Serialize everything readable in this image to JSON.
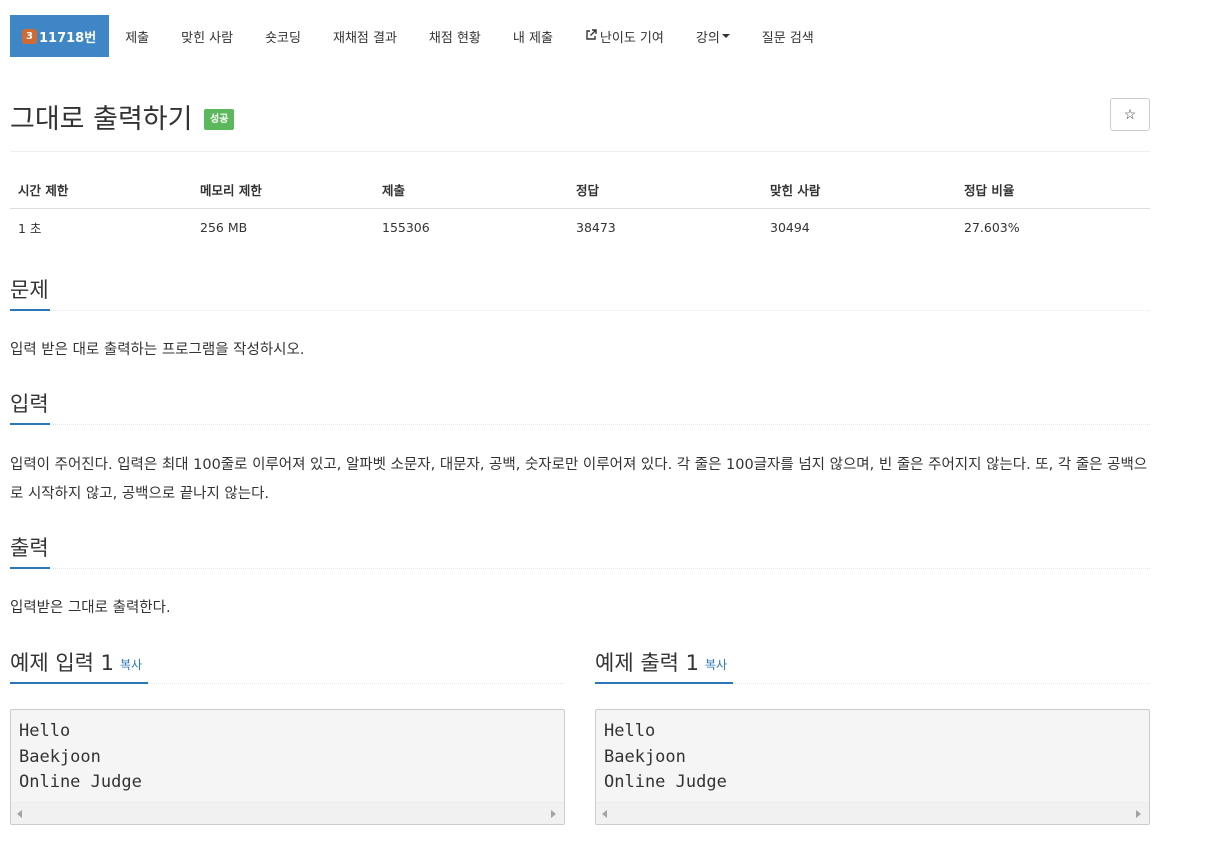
{
  "nav": {
    "problem_tier": "3",
    "problem_id": "11718번",
    "items": [
      "제출",
      "맞힌 사람",
      "숏코딩",
      "재채점 결과",
      "채점 현황",
      "내 제출",
      "난이도 기여",
      "강의",
      "질문 검색"
    ]
  },
  "problem": {
    "title": "그대로 출력하기",
    "status": "성공",
    "star_icon": "☆"
  },
  "info": {
    "headers": [
      "시간 제한",
      "메모리 제한",
      "제출",
      "정답",
      "맞힌 사람",
      "정답 비율"
    ],
    "values": [
      "1 초",
      "256 MB",
      "155306",
      "38473",
      "30494",
      "27.603%"
    ]
  },
  "sections": {
    "description": {
      "heading": "문제",
      "text": "입력 받은 대로 출력하는 프로그램을 작성하시오."
    },
    "input": {
      "heading": "입력",
      "text": "입력이 주어진다. 입력은 최대 100줄로 이루어져 있고, 알파벳 소문자, 대문자, 공백, 숫자로만 이루어져 있다. 각 줄은 100글자를 넘지 않으며, 빈 줄은 주어지지 않는다. 또, 각 줄은 공백으로 시작하지 않고, 공백으로 끝나지 않는다."
    },
    "output": {
      "heading": "출력",
      "text": "입력받은 그대로 출력한다."
    }
  },
  "samples": {
    "input_heading": "예제 입력 1",
    "output_heading": "예제 출력 1",
    "copy_label": "복사",
    "input_text": "Hello\nBaekjoon\nOnline Judge",
    "output_text": "Hello\nBaekjoon\nOnline Judge"
  },
  "colors": {
    "accent": "#2a76b8",
    "nav_active": "#3e86c6",
    "success": "#5cb85c",
    "tier_bronze": "#d06a33"
  }
}
